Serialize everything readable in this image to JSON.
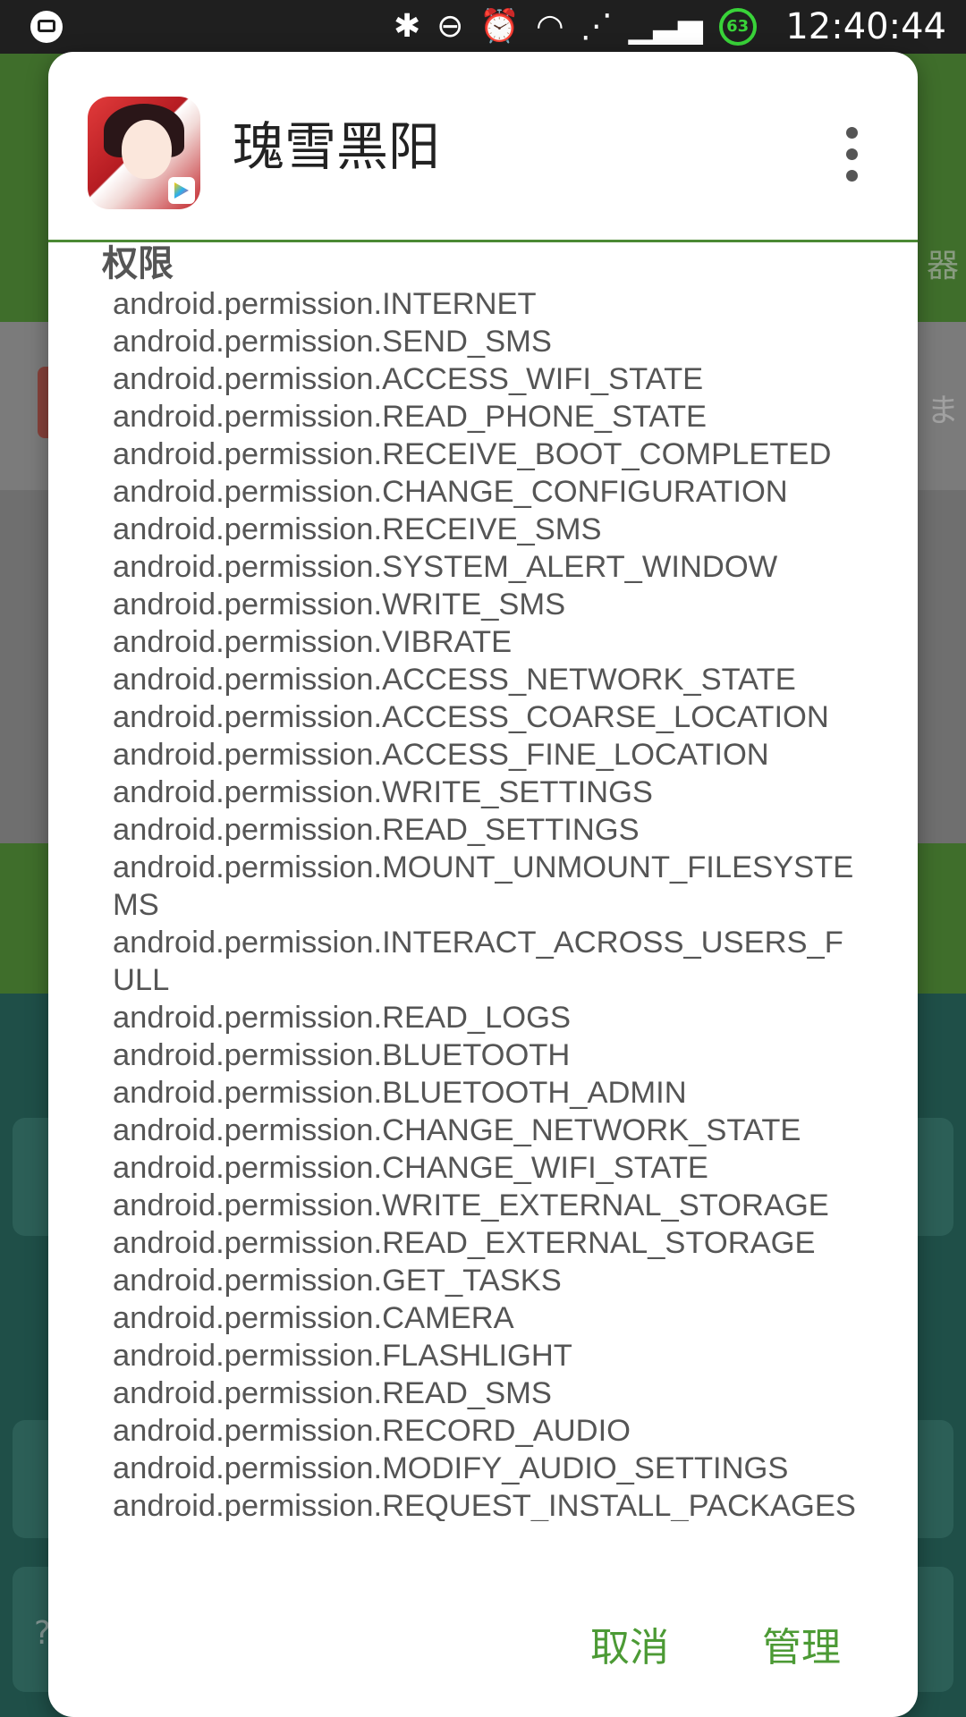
{
  "status_bar": {
    "time": "12:40:44",
    "battery_level": "63",
    "icons": [
      "gallery-icon",
      "bluetooth-icon",
      "do-not-disturb-icon",
      "alarm-icon",
      "wifi-icon",
      "signal-icon",
      "signal-icon",
      "battery-icon"
    ]
  },
  "background": {
    "side_char_top": "器",
    "side_char_mid": "ま",
    "side_char_bottom": "?"
  },
  "dialog": {
    "app_name": "瑰雪黑阳",
    "section_title": "权限",
    "permissions": [
      "android.permission.INTERNET",
      "android.permission.SEND_SMS",
      "android.permission.ACCESS_WIFI_STATE",
      "android.permission.READ_PHONE_STATE",
      "android.permission.RECEIVE_BOOT_COMPLETED",
      "android.permission.CHANGE_CONFIGURATION",
      "android.permission.RECEIVE_SMS",
      "android.permission.SYSTEM_ALERT_WINDOW",
      "android.permission.WRITE_SMS",
      "android.permission.VIBRATE",
      "android.permission.ACCESS_NETWORK_STATE",
      "android.permission.ACCESS_COARSE_LOCATION",
      "android.permission.ACCESS_FINE_LOCATION",
      "android.permission.WRITE_SETTINGS",
      "android.permission.READ_SETTINGS",
      "android.permission.MOUNT_UNMOUNT_FILESYSTEMS",
      "android.permission.INTERACT_ACROSS_USERS_FULL",
      "android.permission.READ_LOGS",
      "android.permission.BLUETOOTH",
      "android.permission.BLUETOOTH_ADMIN",
      "android.permission.CHANGE_NETWORK_STATE",
      "android.permission.CHANGE_WIFI_STATE",
      "android.permission.WRITE_EXTERNAL_STORAGE",
      "android.permission.READ_EXTERNAL_STORAGE",
      "android.permission.GET_TASKS",
      "android.permission.CAMERA",
      "android.permission.FLASHLIGHT",
      "android.permission.READ_SMS",
      "android.permission.RECORD_AUDIO",
      "android.permission.MODIFY_AUDIO_SETTINGS",
      "android.permission.REQUEST_INSTALL_PACKAGES"
    ],
    "cancel_label": "取消",
    "manage_label": "管理"
  },
  "colors": {
    "accent": "#4c9a35",
    "divider": "#4c8a34",
    "battery": "#39d339"
  }
}
